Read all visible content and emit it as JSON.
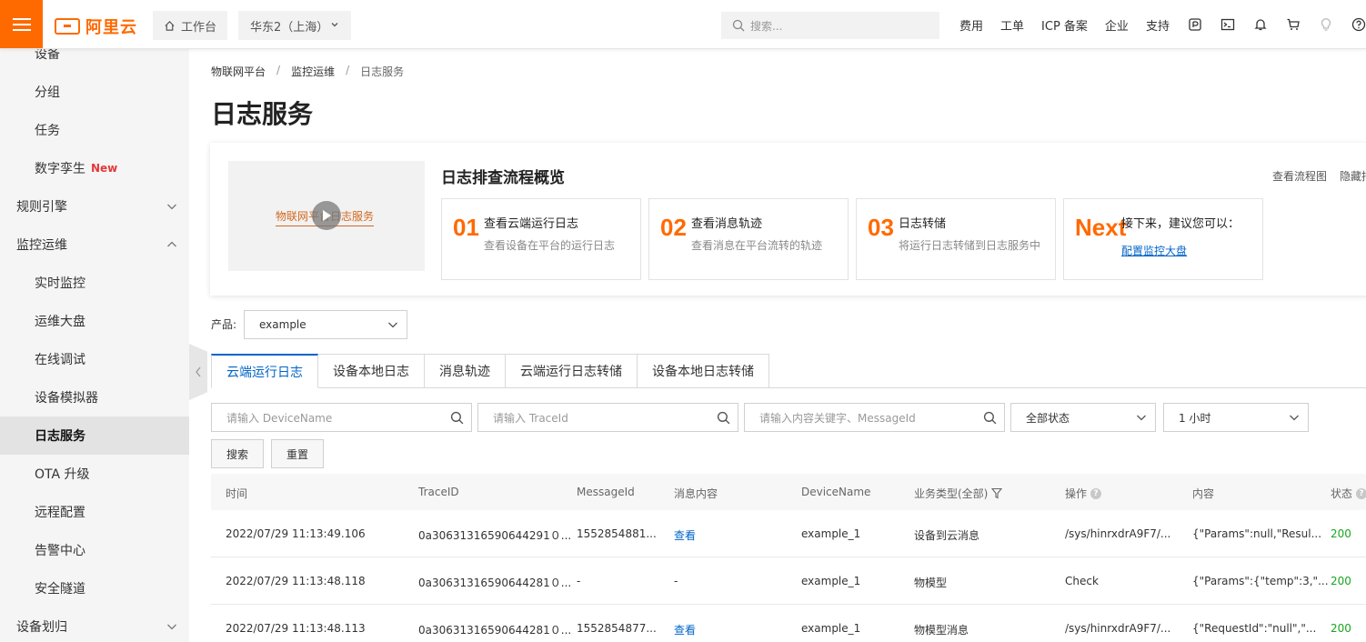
{
  "header": {
    "logo_text": "阿里云",
    "workbench_label": "工作台",
    "region_label": "华东2（上海）",
    "search_placeholder": "搜索...",
    "nav": [
      "费用",
      "工单",
      "ICP 备案",
      "企业",
      "支持"
    ],
    "icons": [
      "app-icon",
      "terminal-icon",
      "bell-icon",
      "cart-icon",
      "bulb-icon",
      "help-icon"
    ]
  },
  "sidebar": {
    "items": [
      {
        "label": "设备",
        "type": "sub"
      },
      {
        "label": "分组",
        "type": "sub"
      },
      {
        "label": "任务",
        "type": "sub"
      },
      {
        "label": "数字孪生",
        "type": "sub",
        "badge": "New"
      },
      {
        "label": "规则引擎",
        "type": "group",
        "expanded": false
      },
      {
        "label": "监控运维",
        "type": "group",
        "expanded": true
      },
      {
        "label": "实时监控",
        "type": "sub"
      },
      {
        "label": "运维大盘",
        "type": "sub"
      },
      {
        "label": "在线调试",
        "type": "sub"
      },
      {
        "label": "设备模拟器",
        "type": "sub"
      },
      {
        "label": "日志服务",
        "type": "sub",
        "active": true
      },
      {
        "label": "OTA 升级",
        "type": "sub"
      },
      {
        "label": "远程配置",
        "type": "sub"
      },
      {
        "label": "告警中心",
        "type": "sub"
      },
      {
        "label": "安全隧道",
        "type": "sub"
      },
      {
        "label": "设备划归",
        "type": "group",
        "expanded": false
      }
    ]
  },
  "breadcrumb": [
    "物联网平台",
    "监控运维",
    "日志服务"
  ],
  "page_title": "日志服务",
  "overview": {
    "video_text": "物联网平台日志服务",
    "title": "日志排查流程概览",
    "links": [
      "查看流程图",
      "隐藏指引"
    ],
    "steps": [
      {
        "num": "01",
        "title": "查看云端运行日志",
        "desc": "查看设备在平台的运行日志"
      },
      {
        "num": "02",
        "title": "查看消息轨迹",
        "desc": "查看消息在平台流转的轨迹"
      },
      {
        "num": "03",
        "title": "日志转储",
        "desc": "将运行日志转储到日志服务中"
      },
      {
        "num": "Next",
        "title": "接下来，建议您可以：",
        "link": "配置监控大盘"
      }
    ]
  },
  "product": {
    "label": "产品:",
    "value": "example"
  },
  "tabs": [
    "云端运行日志",
    "设备本地日志",
    "消息轨迹",
    "云端运行日志转储",
    "设备本地日志转储"
  ],
  "active_tab": 0,
  "filters": {
    "device_placeholder": "请输入 DeviceName",
    "trace_placeholder": "请输入 TraceId",
    "content_placeholder": "请输入内容关键字、MessageId",
    "status_value": "全部状态",
    "time_value": "1 小时",
    "search_label": "搜索",
    "reset_label": "重置"
  },
  "table": {
    "columns": [
      "时间",
      "TraceID",
      "MessageId",
      "消息内容",
      "DeviceName",
      "业务类型(全部)",
      "操作",
      "内容",
      "状态"
    ],
    "rows": [
      [
        "2022/07/29 11:13:49.106",
        "0a30631316590644291０...",
        "1552854881...",
        "查看",
        "example_1",
        "设备到云消息",
        "/sys/hinrxdrA9F7/...",
        "{\"Params\":null,\"Resul...",
        "200"
      ],
      [
        "2022/07/29 11:13:48.118",
        "0a30631316590644281０...",
        "-",
        "-",
        "example_1",
        "物模型",
        "Check",
        "{\"Params\":{\"temp\":3,\"...",
        "200"
      ],
      [
        "2022/07/29 11:13:48.113",
        "0a30631316590644281０...",
        "1552854877...",
        "查看",
        "example_1",
        "物模型消息",
        "/sys/hinrxdrA9F7/...",
        "{\"RequestId\":\"null\",\"...",
        "200"
      ]
    ]
  },
  "colors": {
    "brand": "#ff6a00",
    "link": "#0064c8",
    "success": "#19a51e",
    "new_badge": "#e4393c"
  }
}
